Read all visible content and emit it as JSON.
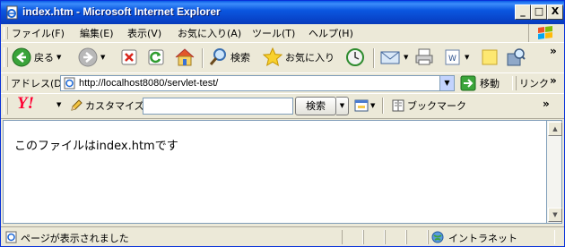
{
  "window": {
    "title": "index.htm - Microsoft Internet Explorer",
    "minimize": "_",
    "maximize": "□",
    "close": "X"
  },
  "menu": [
    {
      "label": "ファイル(F)"
    },
    {
      "label": "編集(E)"
    },
    {
      "label": "表示(V)"
    },
    {
      "label": "お気に入り(A)"
    },
    {
      "label": "ツール(T)"
    },
    {
      "label": "ヘルプ(H)"
    }
  ],
  "toolbar": {
    "back_label": "戻る",
    "search_label": "検索",
    "favorites_label": "お気に入り",
    "overflow": "»"
  },
  "address": {
    "label": "アドレス(D)",
    "url": "http://localhost8080/servlet-test/",
    "go_label": "移動",
    "links_label": "リンク",
    "overflow": "»"
  },
  "yahoo": {
    "logo": "Y!",
    "customize_label": "カスタマイズ",
    "search_value": "",
    "search_button": "検索",
    "bookmark_label": "ブックマーク",
    "overflow": "»"
  },
  "content": {
    "text": "このファイルはindex.htmです"
  },
  "status": {
    "text": "ページが表示されました",
    "zone": "イントラネット"
  },
  "colors": {
    "titlebar": "#0b57e0",
    "chrome": "#ece9d8",
    "yahoo_red": "#ff0033"
  }
}
